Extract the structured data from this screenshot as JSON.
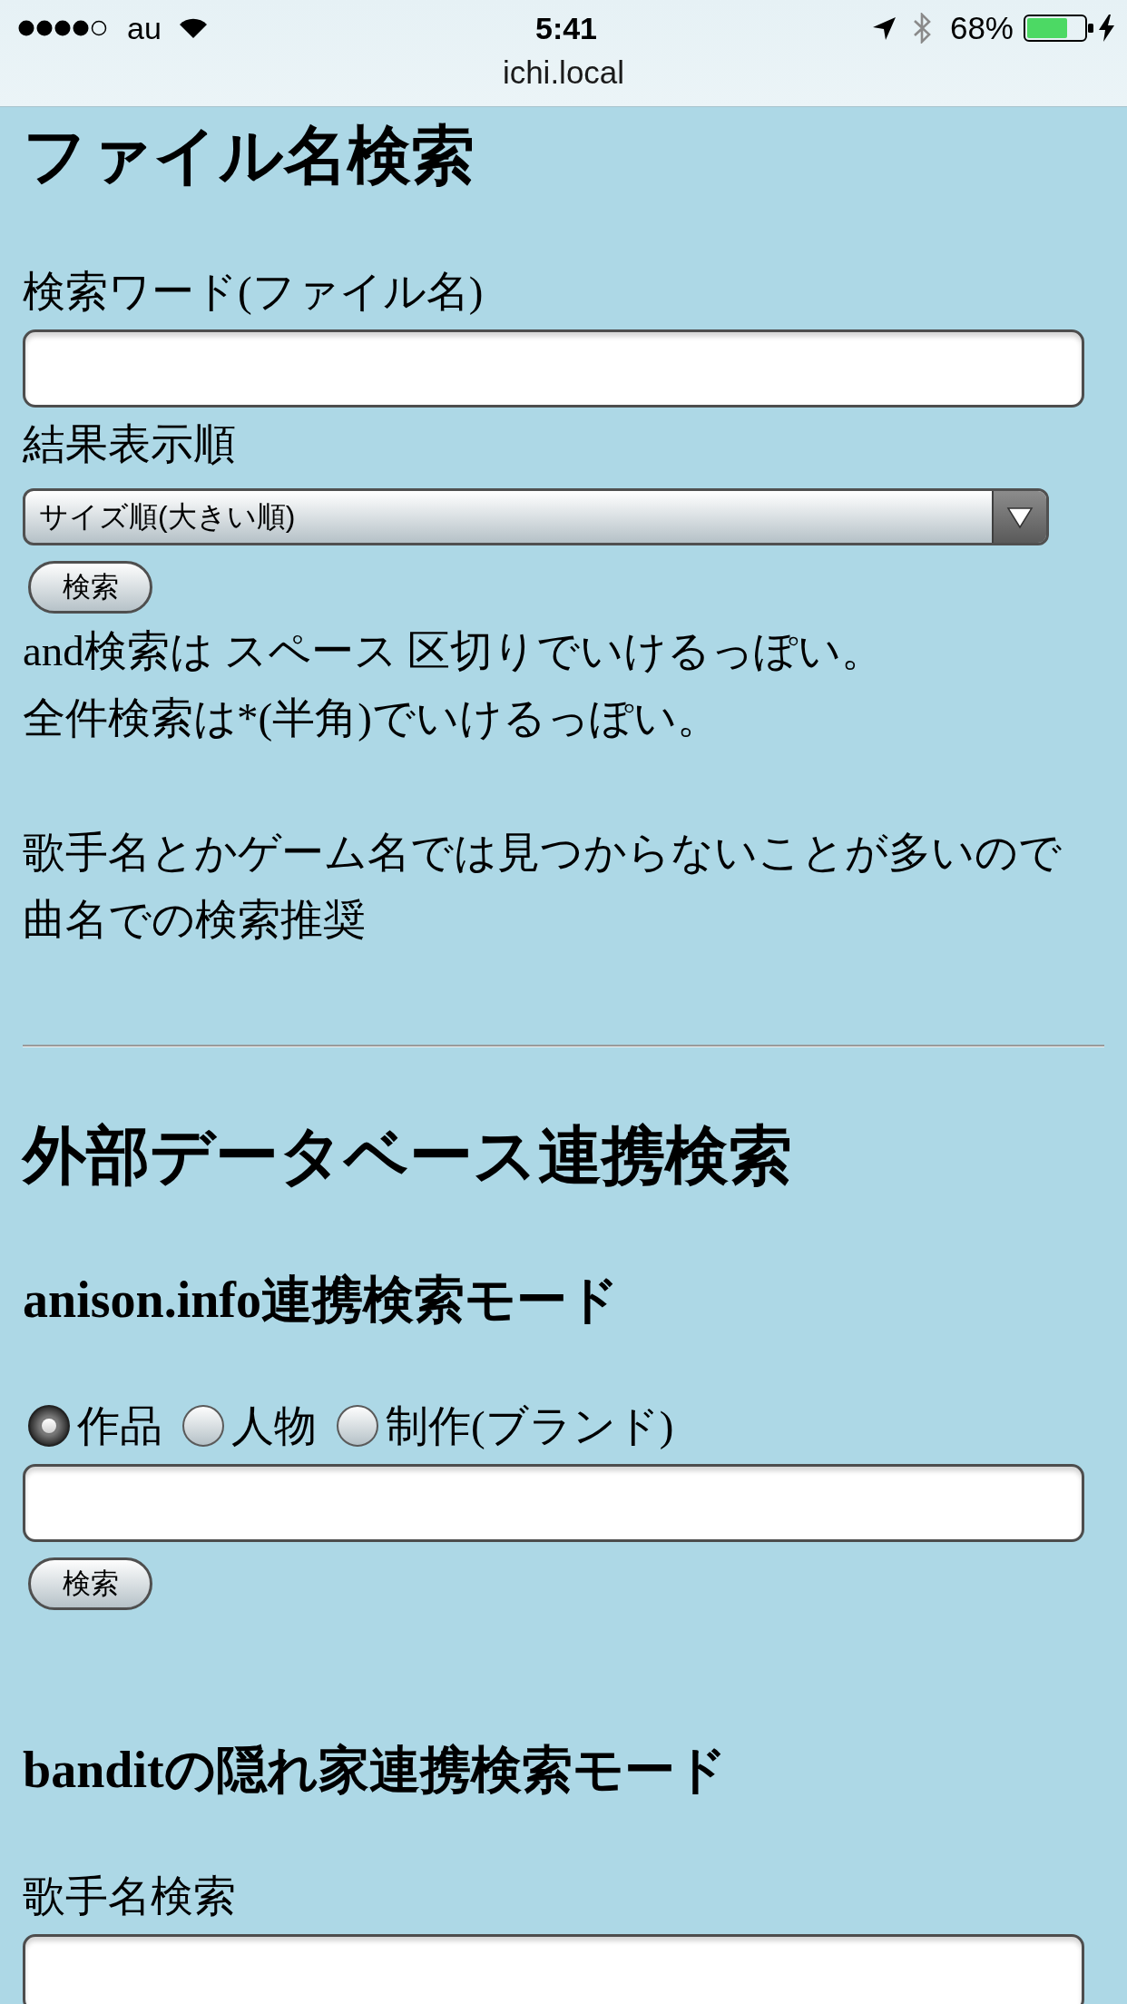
{
  "status_bar": {
    "carrier": "au",
    "time": "5:41",
    "battery": "68%",
    "url": "ichi.local"
  },
  "file_search": {
    "title": "ファイル名検索",
    "items": [
      {
        "kind": "label",
        "text": "検索ワード(ファイル名)"
      },
      {
        "kind": "text_field"
      },
      {
        "kind": "label",
        "text": "結果表示順"
      },
      {
        "kind": "select",
        "value": "サイズ順(大きい順)"
      },
      {
        "kind": "button",
        "label": "検索"
      }
    ],
    "notes": [
      [
        "and検索は スペース 区切りでいけるっぽい。",
        "全件検索は*(半角)でいけるっぽい。"
      ],
      [
        "歌手名とかゲーム名では見つからないことが多いので",
        "曲名での検索推奨"
      ]
    ]
  },
  "external_search": {
    "title": "外部データベース連携検索",
    "modes": [
      {
        "title": "anison.info連携検索モード",
        "items": [
          {
            "kind": "radio_group",
            "options": [
              {
                "label": "作品",
                "selected": true
              },
              {
                "label": "人物",
                "selected": false
              },
              {
                "label": "制作(ブランド)",
                "selected": false
              }
            ]
          },
          {
            "kind": "text_field"
          },
          {
            "kind": "button",
            "label": "検索"
          }
        ]
      },
      {
        "title": "banditの隠れ家連携検索モード",
        "items": [
          {
            "kind": "label",
            "text": "歌手名検索"
          },
          {
            "kind": "text_field"
          }
        ]
      }
    ]
  }
}
